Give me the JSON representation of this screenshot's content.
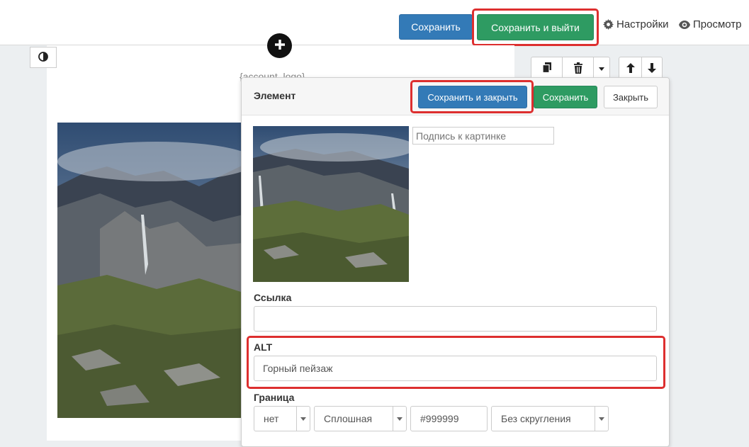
{
  "header": {
    "save_label": "Сохранить",
    "save_exit_label": "Сохранить и выйти",
    "settings_label": "Настройки",
    "preview_label": "Просмотр"
  },
  "canvas": {
    "placeholder_text": "{account_logo}"
  },
  "panel": {
    "title": "Элемент",
    "save_close_label": "Сохранить и закрыть",
    "save_label": "Сохранить",
    "close_label": "Закрыть",
    "caption_placeholder": "Подпись к картинке",
    "link_label": "Ссылка",
    "link_value": "",
    "alt_label": "ALT",
    "alt_value": "Горный пейзаж",
    "border_label": "Граница",
    "border": {
      "width_value": "нет",
      "style_value": "Сплошная",
      "color_value": "#999999",
      "radius_value": "Без скругления"
    }
  },
  "colors": {
    "primary_blue": "#337ab7",
    "success_green": "#2e9b62",
    "highlight_red": "#dd2f2f"
  },
  "icons": [
    "contrast-icon",
    "plus-icon",
    "copy-icon",
    "trash-icon",
    "caret-down-icon",
    "arrow-up-icon",
    "arrow-down-icon",
    "gear-icon",
    "eye-icon"
  ]
}
